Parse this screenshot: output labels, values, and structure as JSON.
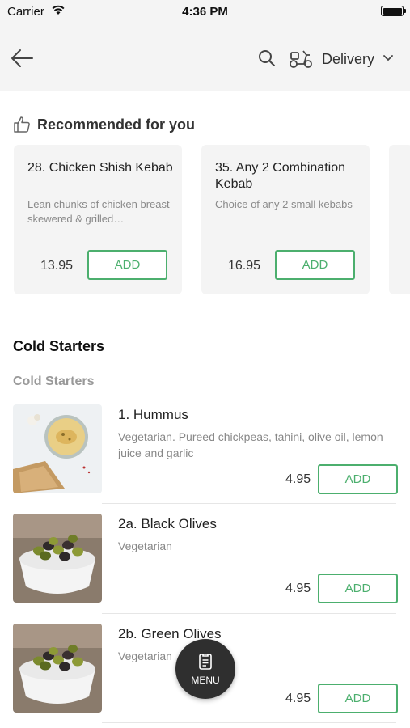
{
  "status_bar": {
    "carrier": "Carrier",
    "time": "4:36 PM"
  },
  "header": {
    "delivery_mode": "Delivery"
  },
  "recommended": {
    "title": "Recommended for you",
    "items": [
      {
        "name": "28. Chicken Shish Kebab",
        "description": "Lean chunks of chicken breast skewered & grilled…",
        "price": "13.95",
        "add_label": "ADD"
      },
      {
        "name": "35. Any 2 Combination Kebab",
        "description": "Choice of any 2 small kebabs",
        "price": "16.95",
        "add_label": "ADD"
      }
    ]
  },
  "section": {
    "title": "Cold Starters",
    "subtitle": "Cold Starters",
    "items": [
      {
        "name": "1. Hummus",
        "description": "Vegetarian. Pureed chickpeas, tahini, olive oil, lemon juice and garlic",
        "price": "4.95",
        "add_label": "ADD"
      },
      {
        "name": "2a. Black Olives",
        "description": "Vegetarian",
        "price": "4.95",
        "add_label": "ADD"
      },
      {
        "name": "2b. Green Olives",
        "description": "Vegetarian",
        "price": "4.95",
        "add_label": "ADD"
      }
    ]
  },
  "menu_fab": {
    "label": "MENU"
  },
  "colors": {
    "accent": "#4caf6e",
    "header_bg": "#f4f4f4",
    "fab_bg": "#2f2f2f"
  }
}
